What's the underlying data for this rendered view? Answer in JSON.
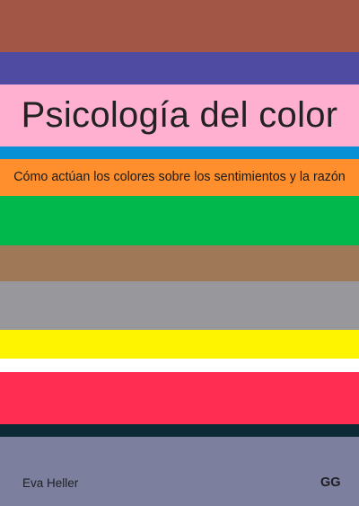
{
  "cover": {
    "title": "Psicología del color",
    "subtitle": "Cómo actúan los colores sobre los sentimientos y la razón",
    "author": "Eva Heller",
    "publisher_logo": "GG"
  },
  "bands": [
    "#a25646",
    "#4f4ba2",
    "#ffb0d0",
    "#0890d4",
    "#ff8f2c",
    "#00b84c",
    "#9f7857",
    "#98989c",
    "#fff400",
    "#ffffff",
    "#ff2d51",
    "#0b2a36",
    "#7d7f9e"
  ]
}
